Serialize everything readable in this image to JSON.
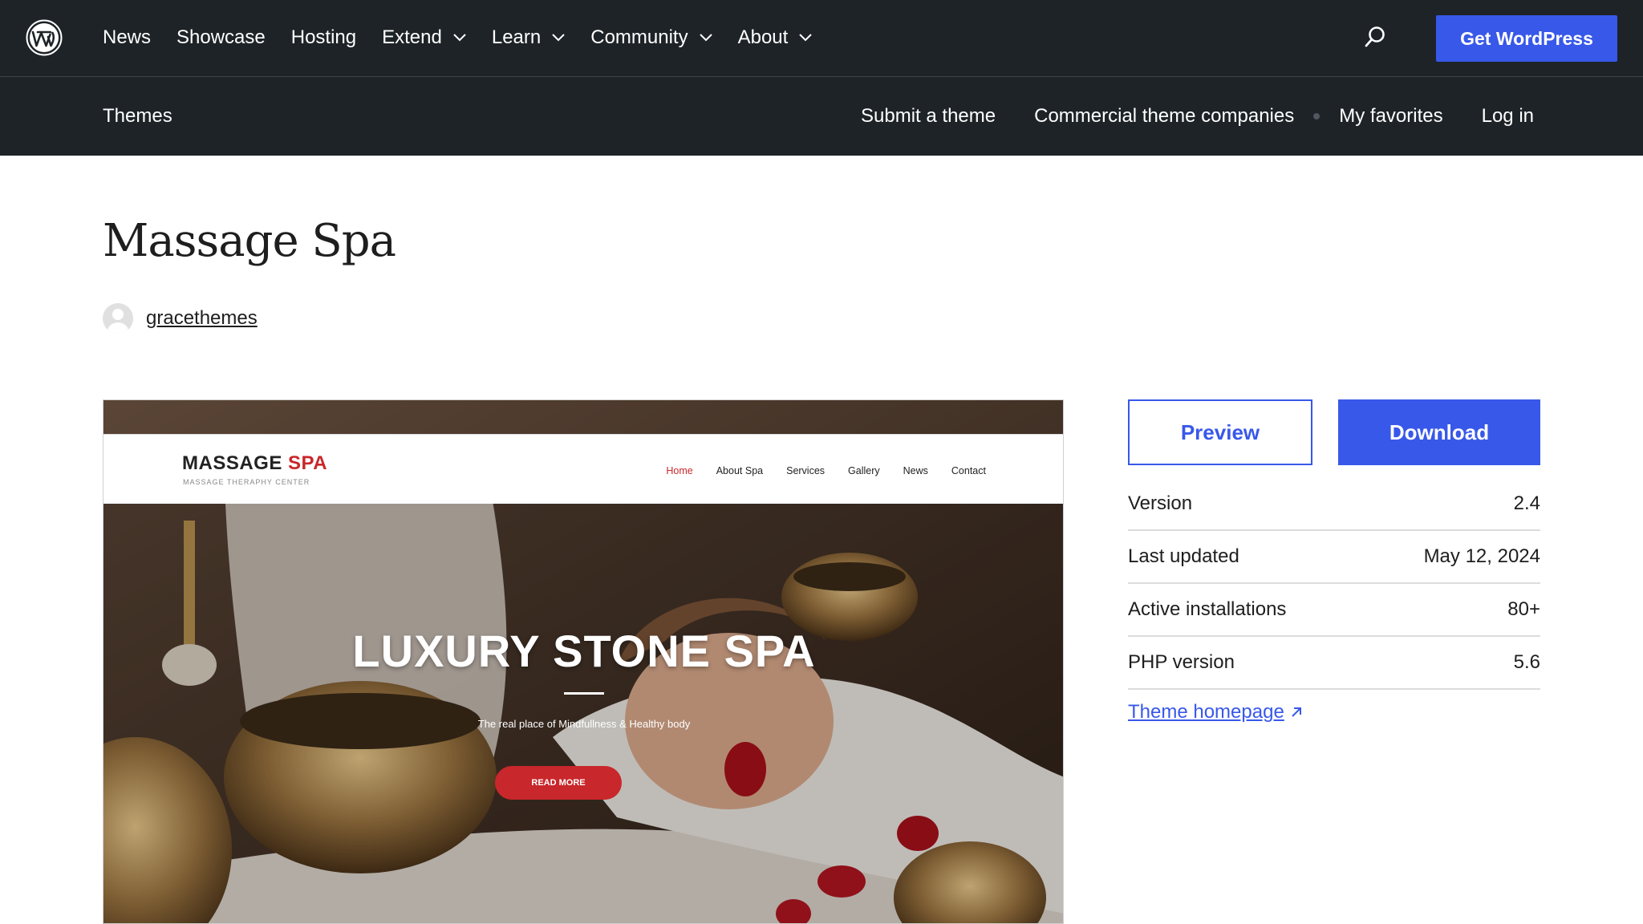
{
  "header": {
    "logo_icon": "wordpress-logo-icon",
    "nav": [
      {
        "label": "News",
        "dropdown": false
      },
      {
        "label": "Showcase",
        "dropdown": false
      },
      {
        "label": "Hosting",
        "dropdown": false
      },
      {
        "label": "Extend",
        "dropdown": true
      },
      {
        "label": "Learn",
        "dropdown": true
      },
      {
        "label": "Community",
        "dropdown": true
      },
      {
        "label": "About",
        "dropdown": true
      }
    ],
    "search_icon": "search-icon",
    "cta_label": "Get WordPress"
  },
  "subheader": {
    "title": "Themes",
    "links": [
      "Submit a theme",
      "Commercial theme companies",
      "My favorites",
      "Log in"
    ]
  },
  "theme": {
    "name": "Massage Spa",
    "author": "gracethemes"
  },
  "screenshot": {
    "logo_main": "MASSAGE",
    "logo_accent": "SPA",
    "tagline": "MASSAGE THERAPHY CENTER",
    "menu": [
      "Home",
      "About Spa",
      "Services",
      "Gallery",
      "News",
      "Contact"
    ],
    "hero_title": "LUXURY STONE SPA",
    "hero_subtitle": "The real place of Mindfullness & Healthy body",
    "hero_button": "READ MORE"
  },
  "sidebar": {
    "preview_label": "Preview",
    "download_label": "Download",
    "meta": [
      {
        "label": "Version",
        "value": "2.4"
      },
      {
        "label": "Last updated",
        "value": "May 12, 2024"
      },
      {
        "label": "Active installations",
        "value": "80+"
      },
      {
        "label": "PHP version",
        "value": "5.6"
      }
    ],
    "homepage_label": "Theme homepage"
  },
  "colors": {
    "header_bg": "#1d2327",
    "accent": "#3858e9",
    "spa_red": "#c8272b"
  }
}
